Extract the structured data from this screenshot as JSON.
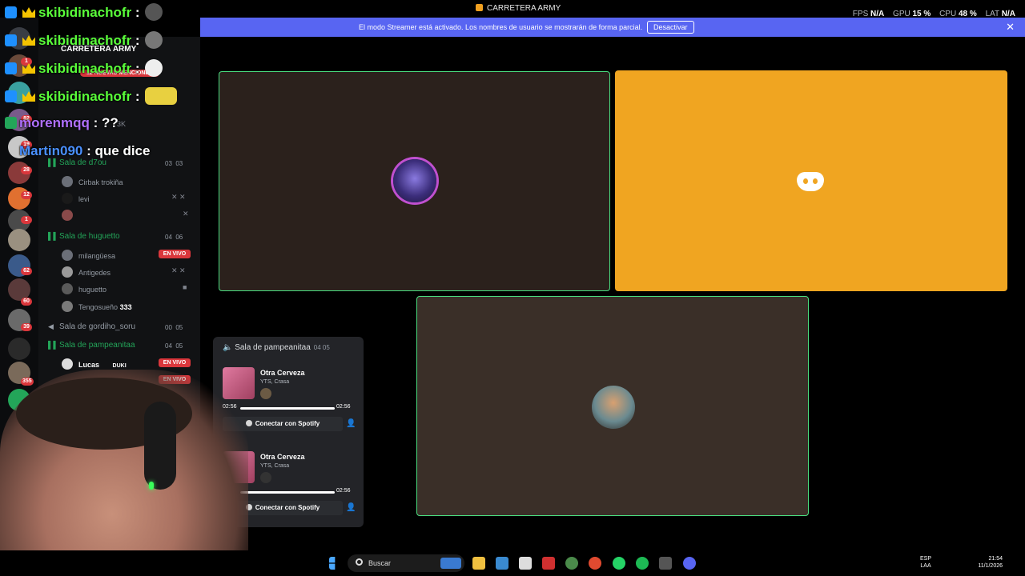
{
  "titlebar": {
    "app_title": "CARRETERA ARMY"
  },
  "stats": {
    "fps_label": "FPS",
    "fps_value": "N/A",
    "gpu_label": "GPU",
    "gpu_value": "15 %",
    "cpu_label": "CPU",
    "cpu_value": "48 %",
    "lat_label": "LAT",
    "lat_value": "N/A"
  },
  "banner": {
    "text": "El modo Streamer está activado. Los nombres de usuario se mostrarán de forma parcial.",
    "button": "Desactivar"
  },
  "server": {
    "name": "CARRETERA ARMY",
    "mentions": "12 NUEVAS MENCIONES",
    "member_count": "3K"
  },
  "server_badges": [
    "1",
    "82",
    "19",
    "28",
    "12",
    "1",
    "62",
    "60",
    "39",
    "355"
  ],
  "channels": [
    {
      "name": "Sala de d7ou",
      "count_a": "03",
      "count_b": "03",
      "active": true
    },
    {
      "name": "Sala de huguetto",
      "count_a": "04",
      "count_b": "06",
      "active": true
    },
    {
      "name": "Sala de gordiho_soru",
      "count_a": "00",
      "count_b": "05",
      "active": false
    },
    {
      "name": "Sala de pampeanitaa",
      "count_a": "04",
      "count_b": "05",
      "active": true
    }
  ],
  "members": {
    "d7ou": [
      "Cirbak trokiña",
      "levi",
      ""
    ],
    "huguetto": [
      "milangüesa",
      "Antigedes",
      "huguetto",
      "Tengosueño"
    ],
    "pampeanitaa": [
      "Lucas"
    ]
  },
  "tengosueno_count": "333",
  "lucas_tag": "DUKI",
  "live_label": "EN VIVO",
  "chat": [
    {
      "user": "skibidinachofr",
      "msg": ":"
    },
    {
      "user": "skibidinachofr",
      "msg": ":"
    },
    {
      "user": "skibidinachofr",
      "msg": ":"
    },
    {
      "user": "skibidinachofr",
      "msg": ":"
    },
    {
      "user": "morenmqq",
      "msg": ": ??"
    },
    {
      "user": "Martin090",
      "msg": ": que dice"
    }
  ],
  "popup": {
    "channel": "Sala de pampeanitaa",
    "count": "04 05",
    "cards": [
      {
        "title": "Otra Cerveza",
        "artist": "YTS, Crasa",
        "t0": "02:56",
        "t1": "02:56",
        "button": "Conectar con Spotify"
      },
      {
        "title": "Otra Cerveza",
        "artist": "YTS, Crasa",
        "t0": "56",
        "t1": "02:56",
        "button": "Conectar con Spotify"
      }
    ]
  },
  "extra_count": "05",
  "taskbar": {
    "search": "Buscar",
    "lang_1": "ESP",
    "lang_2": "LAA",
    "time": "21:54",
    "date": "11/1/2026"
  },
  "colors": {
    "brand": "#5865f2",
    "live": "#da373c",
    "speaking": "#4ade80",
    "tile_orange": "#f0a521"
  }
}
